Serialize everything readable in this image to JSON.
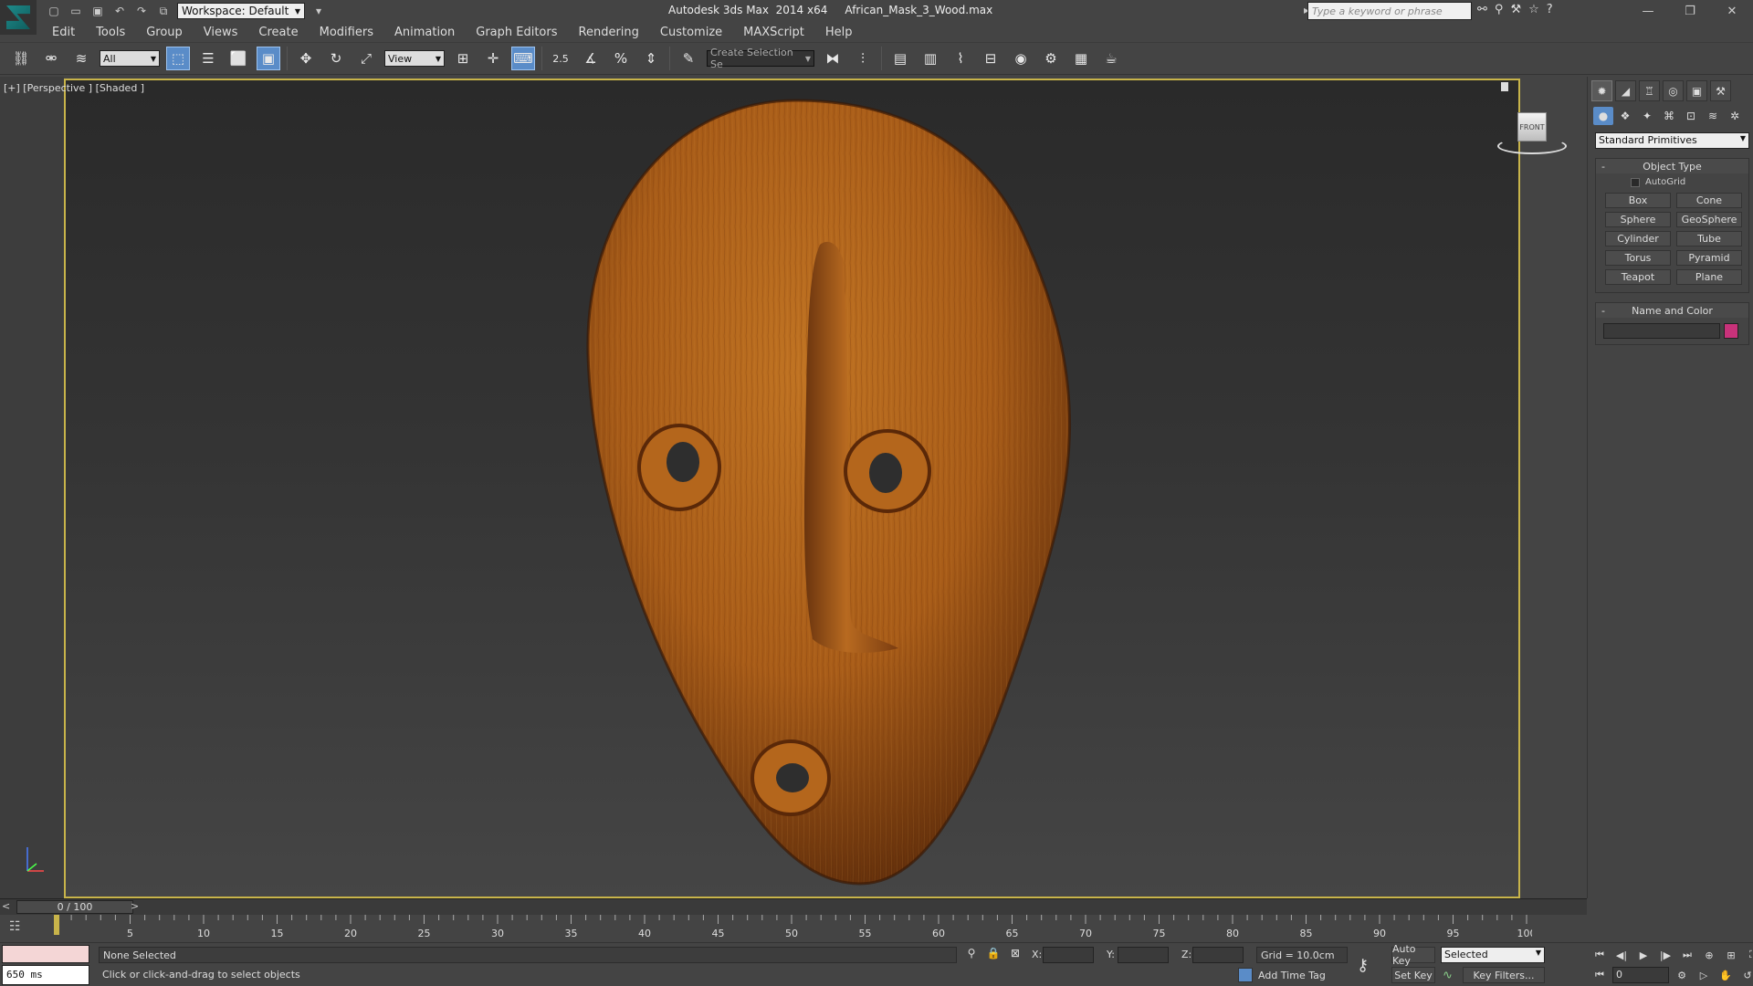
{
  "window": {
    "title": "Autodesk 3ds Max  2014 x64     African_Mask_3_Wood.max",
    "workspace": "Workspace: Default",
    "search_placeholder": "Type a keyword or phrase"
  },
  "menu": [
    "Edit",
    "Tools",
    "Group",
    "Views",
    "Create",
    "Modifiers",
    "Animation",
    "Graph Editors",
    "Rendering",
    "Customize",
    "MAXScript",
    "Help"
  ],
  "toolbar": {
    "selection_filter": "All",
    "ref_coord": "View",
    "snap_label": "2.5",
    "selection_set_placeholder": "Create Selection Se"
  },
  "viewport": {
    "label": "[+] [Perspective ] [Shaded ]",
    "viewcube_face": "FRONT",
    "object_colors": {
      "wood_light": "#b8681e",
      "wood_dark": "#5a2a0a"
    }
  },
  "command_panel": {
    "primitive_type": "Standard Primitives",
    "object_type_title": "Object Type",
    "autogrid_label": "AutoGrid",
    "primitives": [
      "Box",
      "Cone",
      "Sphere",
      "GeoSphere",
      "Cylinder",
      "Tube",
      "Torus",
      "Pyramid",
      "Teapot",
      "Plane"
    ],
    "name_color_title": "Name and Color",
    "object_color": "#c8327a"
  },
  "timeline": {
    "position": "0 / 100",
    "current_frame": 0,
    "ticks": [
      5,
      10,
      15,
      20,
      25,
      30,
      35,
      40,
      45,
      50,
      55,
      60,
      65,
      70,
      75,
      80,
      85,
      90,
      95,
      100
    ],
    "max_frame": 100
  },
  "status": {
    "maxscript_output": "650 ms",
    "selection": "None Selected",
    "prompt": "Click or click-and-drag to select objects",
    "x_label": "X:",
    "y_label": "Y:",
    "z_label": "Z:",
    "grid": "Grid = 10.0cm",
    "add_time_tag": "Add Time Tag",
    "auto_key": "Auto Key",
    "set_key": "Set Key",
    "key_mode": "Selected",
    "key_filters": "Key Filters...",
    "frame": "0"
  }
}
